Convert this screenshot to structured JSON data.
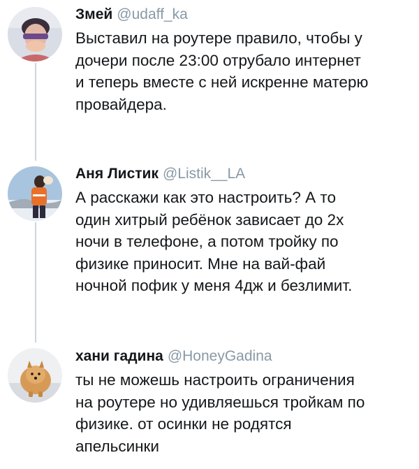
{
  "tweets": [
    {
      "name": "Змей",
      "handle": "@udaff_ka",
      "avatar_icon": "boy-avatar",
      "text_lines": [
        "Выставил на роутере правило, чтобы у",
        "дочери после 23:00 отрубало интернет",
        "и теперь вместе с ней искренне матерю",
        "провайдера."
      ]
    },
    {
      "name": "Аня Листик",
      "handle": "@Listik__LA",
      "avatar_icon": "woman-in-orange-avatar",
      "text_lines": [
        "А расскажи как это настроить? А то",
        "один хитрый ребёнок зависает до 2х",
        "ночи в телефоне, а потом тройку по",
        "физике приносит. Мне на вай-фай",
        "ночной пофик у меня 4дж и безлимит."
      ]
    },
    {
      "name": "хани гадина",
      "handle": "@HoneyGadina",
      "avatar_icon": "pomeranian-dog-avatar",
      "text_lines": [
        "ты не можешь настроить ограничения",
        "на роутере но удивляешься тройкам по",
        "физике. от осинки не родятся",
        "апельсинки"
      ]
    }
  ],
  "colors": {
    "text": "#14171a",
    "handle": "#8899a6",
    "thread_line": "#ccd6dd"
  }
}
